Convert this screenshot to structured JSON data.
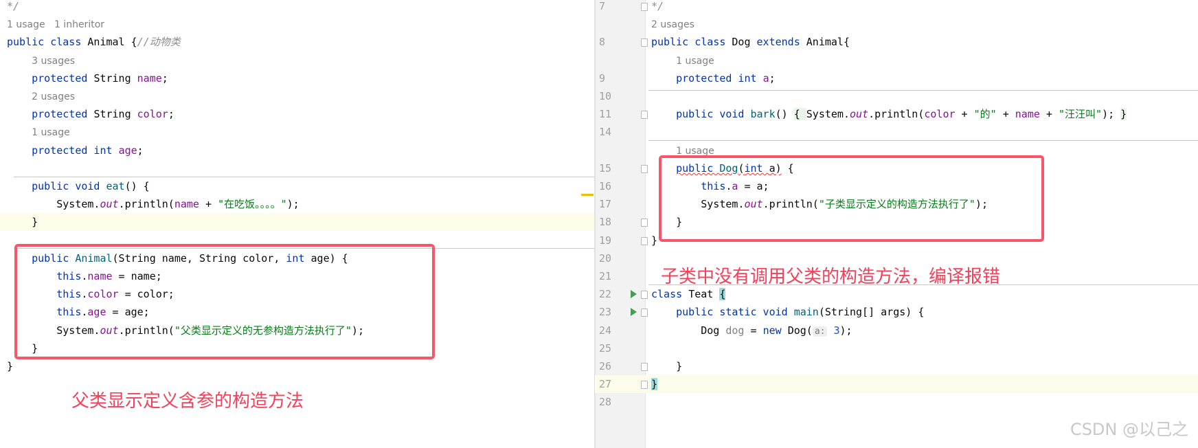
{
  "left_editor": {
    "lines": [
      [
        [
          "*/",
          "cmt"
        ]
      ],
      [
        [
          "1 usage   1 inheritor",
          "hint"
        ]
      ],
      [
        [
          "public class ",
          "kw"
        ],
        [
          "Animal {",
          ""
        ],
        [
          "//动物类",
          "cmt"
        ]
      ],
      [
        [
          "    ",
          ""
        ],
        [
          "3 usages",
          "hint"
        ]
      ],
      [
        [
          "    ",
          ""
        ],
        [
          "protected ",
          "kw"
        ],
        [
          "String ",
          ""
        ],
        [
          "name",
          "fld"
        ],
        [
          ";",
          ""
        ]
      ],
      [
        [
          "    ",
          ""
        ],
        [
          "2 usages",
          "hint"
        ]
      ],
      [
        [
          "    ",
          ""
        ],
        [
          "protected ",
          "kw"
        ],
        [
          "String ",
          ""
        ],
        [
          "color",
          "fld"
        ],
        [
          ";",
          ""
        ]
      ],
      [
        [
          "    ",
          ""
        ],
        [
          "1 usage",
          "hint"
        ]
      ],
      [
        [
          "    ",
          ""
        ],
        [
          "protected int ",
          "kw"
        ],
        [
          "age",
          "fld"
        ],
        [
          ";",
          ""
        ]
      ],
      [],
      [
        [
          "    ",
          ""
        ],
        [
          "public void ",
          "kw"
        ],
        [
          "eat",
          "mth"
        ],
        [
          "() {",
          ""
        ]
      ],
      [
        [
          "        System.",
          ""
        ],
        [
          "out",
          "st"
        ],
        [
          ".println(",
          ""
        ],
        [
          "name",
          "fld"
        ],
        [
          " + ",
          ""
        ],
        [
          "\"在吃饭。。。。\"",
          "str"
        ],
        [
          ");",
          ""
        ]
      ],
      [
        [
          "    }",
          ""
        ]
      ],
      [],
      [
        [
          "    ",
          ""
        ],
        [
          "public ",
          "kw"
        ],
        [
          "Animal",
          "mth"
        ],
        [
          "(String name, String color, ",
          ""
        ],
        [
          "int ",
          "kw"
        ],
        [
          "age) {",
          ""
        ]
      ],
      [
        [
          "        ",
          ""
        ],
        [
          "this",
          "kw"
        ],
        [
          ".",
          ""
        ],
        [
          "name",
          "fld"
        ],
        [
          " = name;",
          ""
        ]
      ],
      [
        [
          "        ",
          ""
        ],
        [
          "this",
          "kw"
        ],
        [
          ".",
          ""
        ],
        [
          "color",
          "fld"
        ],
        [
          " = color;",
          ""
        ]
      ],
      [
        [
          "        ",
          ""
        ],
        [
          "this",
          "kw"
        ],
        [
          ".",
          ""
        ],
        [
          "age",
          "fld"
        ],
        [
          " = age;",
          ""
        ]
      ],
      [
        [
          "        System.",
          ""
        ],
        [
          "out",
          "st"
        ],
        [
          ".println(",
          ""
        ],
        [
          "\"父类显示定义的无参构造方法执行了\"",
          "str"
        ],
        [
          ");",
          ""
        ]
      ],
      [
        [
          "    }",
          ""
        ]
      ],
      [
        [
          "}",
          ""
        ]
      ]
    ],
    "annotation": "父类显示定义含参的构造方法"
  },
  "right_editor": {
    "lines": [
      {
        "n": "7",
        "t": [
          [
            "*/",
            "cmt"
          ]
        ]
      },
      {
        "n": "",
        "t": [
          [
            "2 usages",
            "hint"
          ]
        ]
      },
      {
        "n": "8",
        "t": [
          [
            "public class ",
            "kw"
          ],
          [
            "Dog ",
            ""
          ],
          [
            "extends ",
            "kw"
          ],
          [
            "Animal{",
            ""
          ]
        ]
      },
      {
        "n": "",
        "t": [
          [
            "    ",
            ""
          ],
          [
            "1 usage",
            "hint"
          ]
        ]
      },
      {
        "n": "9",
        "t": [
          [
            "    ",
            ""
          ],
          [
            "protected int ",
            "kw"
          ],
          [
            "a",
            "fld"
          ],
          [
            ";",
            ""
          ]
        ]
      },
      {
        "n": "10",
        "t": []
      },
      {
        "n": "11",
        "t": [
          [
            "    ",
            ""
          ],
          [
            "public void ",
            "kw"
          ],
          [
            "bark",
            "mth"
          ],
          [
            "() ",
            ""
          ],
          [
            "{ ",
            "greenbg"
          ],
          [
            "System.",
            ""
          ],
          [
            "out",
            "st"
          ],
          [
            ".println(",
            ""
          ],
          [
            "color",
            "fld"
          ],
          [
            " + ",
            ""
          ],
          [
            "\"的\"",
            "str"
          ],
          [
            " + ",
            ""
          ],
          [
            "name",
            "fld"
          ],
          [
            " + ",
            ""
          ],
          [
            "\"汪汪叫\"",
            "str"
          ],
          [
            "); ",
            ""
          ],
          [
            "}",
            "greenbg"
          ]
        ]
      },
      {
        "n": "14",
        "t": []
      },
      {
        "n": "",
        "t": [
          [
            "    ",
            ""
          ],
          [
            "1 usage",
            "hint"
          ]
        ]
      },
      {
        "n": "15",
        "t": [
          [
            "    ",
            ""
          ],
          [
            "public ",
            "kw err"
          ],
          [
            "Dog",
            "mth err"
          ],
          [
            "(",
            "err"
          ],
          [
            "int ",
            "kw err"
          ],
          [
            "a)",
            "err"
          ],
          [
            " {",
            ""
          ]
        ]
      },
      {
        "n": "16",
        "t": [
          [
            "        ",
            ""
          ],
          [
            "this",
            "kw"
          ],
          [
            ".",
            ""
          ],
          [
            "a",
            "fld"
          ],
          [
            " = a;",
            ""
          ]
        ]
      },
      {
        "n": "17",
        "t": [
          [
            "        System.",
            ""
          ],
          [
            "out",
            "st"
          ],
          [
            ".println(",
            ""
          ],
          [
            "\"子类显示定义的构造方法执行了\"",
            "str"
          ],
          [
            ");",
            ""
          ]
        ]
      },
      {
        "n": "18",
        "t": [
          [
            "    }",
            ""
          ]
        ]
      },
      {
        "n": "19",
        "t": [
          [
            "}",
            ""
          ]
        ]
      },
      {
        "n": "20",
        "t": []
      },
      {
        "n": "21",
        "t": []
      },
      {
        "n": "22",
        "t": [
          [
            "class ",
            "kw"
          ],
          [
            "Teat ",
            ""
          ],
          [
            "{",
            "brace"
          ]
        ],
        "run": true
      },
      {
        "n": "23",
        "t": [
          [
            "    ",
            ""
          ],
          [
            "public static void ",
            "kw"
          ],
          [
            "main",
            "mth"
          ],
          [
            "(String[] args) {",
            ""
          ]
        ],
        "run": true
      },
      {
        "n": "24",
        "t": [
          [
            "        Dog ",
            ""
          ],
          [
            "dog",
            "var"
          ],
          [
            " = ",
            ""
          ],
          [
            "new ",
            "kw"
          ],
          [
            "Dog(",
            ""
          ],
          [
            "a:",
            "inlay"
          ],
          [
            " ",
            ""
          ],
          [
            "3",
            "num"
          ],
          [
            ");",
            ""
          ]
        ]
      },
      {
        "n": "25",
        "t": []
      },
      {
        "n": "26",
        "t": [
          [
            "    }",
            ""
          ]
        ]
      },
      {
        "n": "27",
        "t": [
          [
            "}",
            "brace"
          ]
        ],
        "hl": true
      },
      {
        "n": "28",
        "t": []
      }
    ],
    "annotation": "子类中没有调用父类的构造方法，编译报错"
  },
  "watermark": "CSDN @以己之",
  "colors": {
    "keyword": "#0033b3",
    "field": "#871094",
    "string": "#067d17",
    "annotation": "#f5405a"
  }
}
